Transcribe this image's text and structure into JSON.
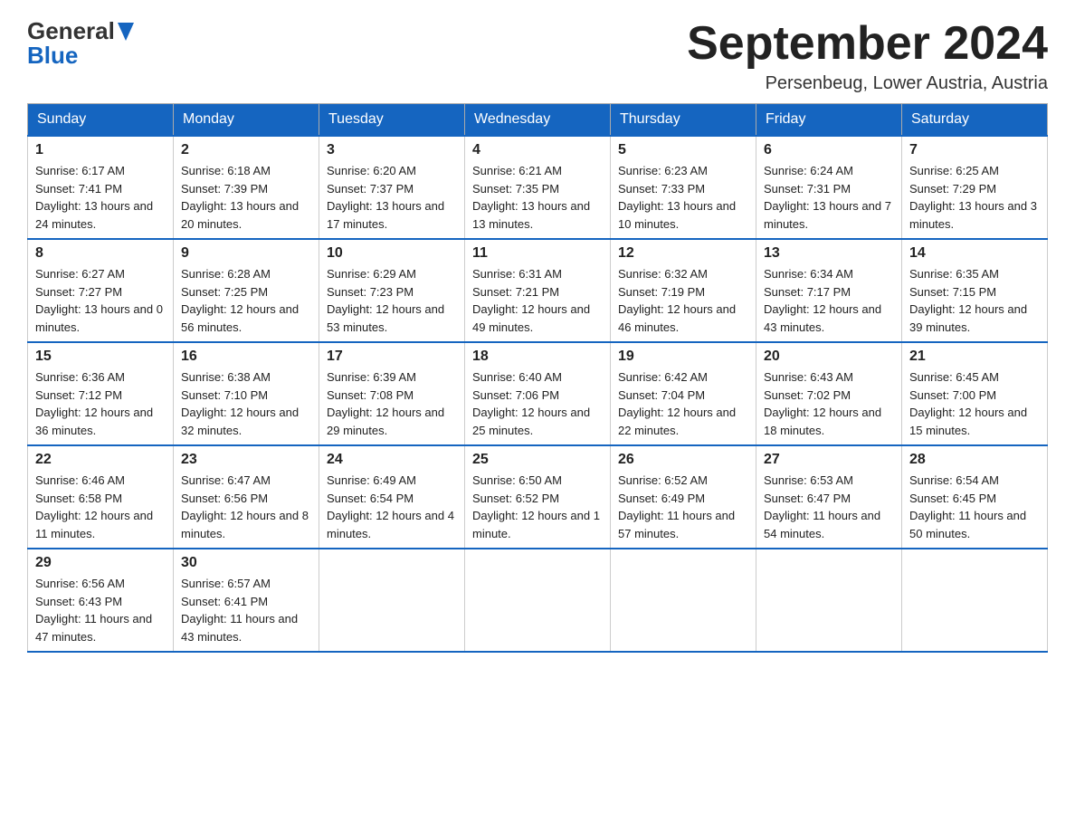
{
  "header": {
    "logo_line1": "General",
    "logo_line2": "Blue",
    "month_title": "September 2024",
    "location": "Persenbeug, Lower Austria, Austria"
  },
  "weekdays": [
    "Sunday",
    "Monday",
    "Tuesday",
    "Wednesday",
    "Thursday",
    "Friday",
    "Saturday"
  ],
  "weeks": [
    [
      {
        "day": "1",
        "sunrise": "6:17 AM",
        "sunset": "7:41 PM",
        "daylight": "13 hours and 24 minutes."
      },
      {
        "day": "2",
        "sunrise": "6:18 AM",
        "sunset": "7:39 PM",
        "daylight": "13 hours and 20 minutes."
      },
      {
        "day": "3",
        "sunrise": "6:20 AM",
        "sunset": "7:37 PM",
        "daylight": "13 hours and 17 minutes."
      },
      {
        "day": "4",
        "sunrise": "6:21 AM",
        "sunset": "7:35 PM",
        "daylight": "13 hours and 13 minutes."
      },
      {
        "day": "5",
        "sunrise": "6:23 AM",
        "sunset": "7:33 PM",
        "daylight": "13 hours and 10 minutes."
      },
      {
        "day": "6",
        "sunrise": "6:24 AM",
        "sunset": "7:31 PM",
        "daylight": "13 hours and 7 minutes."
      },
      {
        "day": "7",
        "sunrise": "6:25 AM",
        "sunset": "7:29 PM",
        "daylight": "13 hours and 3 minutes."
      }
    ],
    [
      {
        "day": "8",
        "sunrise": "6:27 AM",
        "sunset": "7:27 PM",
        "daylight": "13 hours and 0 minutes."
      },
      {
        "day": "9",
        "sunrise": "6:28 AM",
        "sunset": "7:25 PM",
        "daylight": "12 hours and 56 minutes."
      },
      {
        "day": "10",
        "sunrise": "6:29 AM",
        "sunset": "7:23 PM",
        "daylight": "12 hours and 53 minutes."
      },
      {
        "day": "11",
        "sunrise": "6:31 AM",
        "sunset": "7:21 PM",
        "daylight": "12 hours and 49 minutes."
      },
      {
        "day": "12",
        "sunrise": "6:32 AM",
        "sunset": "7:19 PM",
        "daylight": "12 hours and 46 minutes."
      },
      {
        "day": "13",
        "sunrise": "6:34 AM",
        "sunset": "7:17 PM",
        "daylight": "12 hours and 43 minutes."
      },
      {
        "day": "14",
        "sunrise": "6:35 AM",
        "sunset": "7:15 PM",
        "daylight": "12 hours and 39 minutes."
      }
    ],
    [
      {
        "day": "15",
        "sunrise": "6:36 AM",
        "sunset": "7:12 PM",
        "daylight": "12 hours and 36 minutes."
      },
      {
        "day": "16",
        "sunrise": "6:38 AM",
        "sunset": "7:10 PM",
        "daylight": "12 hours and 32 minutes."
      },
      {
        "day": "17",
        "sunrise": "6:39 AM",
        "sunset": "7:08 PM",
        "daylight": "12 hours and 29 minutes."
      },
      {
        "day": "18",
        "sunrise": "6:40 AM",
        "sunset": "7:06 PM",
        "daylight": "12 hours and 25 minutes."
      },
      {
        "day": "19",
        "sunrise": "6:42 AM",
        "sunset": "7:04 PM",
        "daylight": "12 hours and 22 minutes."
      },
      {
        "day": "20",
        "sunrise": "6:43 AM",
        "sunset": "7:02 PM",
        "daylight": "12 hours and 18 minutes."
      },
      {
        "day": "21",
        "sunrise": "6:45 AM",
        "sunset": "7:00 PM",
        "daylight": "12 hours and 15 minutes."
      }
    ],
    [
      {
        "day": "22",
        "sunrise": "6:46 AM",
        "sunset": "6:58 PM",
        "daylight": "12 hours and 11 minutes."
      },
      {
        "day": "23",
        "sunrise": "6:47 AM",
        "sunset": "6:56 PM",
        "daylight": "12 hours and 8 minutes."
      },
      {
        "day": "24",
        "sunrise": "6:49 AM",
        "sunset": "6:54 PM",
        "daylight": "12 hours and 4 minutes."
      },
      {
        "day": "25",
        "sunrise": "6:50 AM",
        "sunset": "6:52 PM",
        "daylight": "12 hours and 1 minute."
      },
      {
        "day": "26",
        "sunrise": "6:52 AM",
        "sunset": "6:49 PM",
        "daylight": "11 hours and 57 minutes."
      },
      {
        "day": "27",
        "sunrise": "6:53 AM",
        "sunset": "6:47 PM",
        "daylight": "11 hours and 54 minutes."
      },
      {
        "day": "28",
        "sunrise": "6:54 AM",
        "sunset": "6:45 PM",
        "daylight": "11 hours and 50 minutes."
      }
    ],
    [
      {
        "day": "29",
        "sunrise": "6:56 AM",
        "sunset": "6:43 PM",
        "daylight": "11 hours and 47 minutes."
      },
      {
        "day": "30",
        "sunrise": "6:57 AM",
        "sunset": "6:41 PM",
        "daylight": "11 hours and 43 minutes."
      },
      null,
      null,
      null,
      null,
      null
    ]
  ]
}
